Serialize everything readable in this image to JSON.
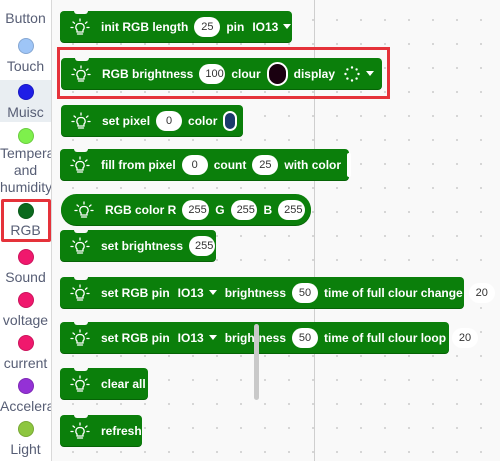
{
  "sidebar": {
    "categories": [
      {
        "label": "Button",
        "color": "#9ec5f7"
      },
      {
        "label": "Touch",
        "color": "#9ec5f7"
      },
      {
        "label": "Muisc",
        "color": "#1e1ee6"
      },
      {
        "label": "Temperature and humidity",
        "lines": [
          "Tempera",
          "and",
          "humidity"
        ],
        "color": "#7ef04c"
      },
      {
        "label": "RGB",
        "color": "#0b6a1e"
      },
      {
        "label": "Sound",
        "color": "#f0186d"
      },
      {
        "label": "voltage",
        "color": "#f0186d"
      },
      {
        "label": "current",
        "color": "#f0186d"
      },
      {
        "label": "Accelera",
        "color": "#9431d6"
      },
      {
        "label": "Light",
        "color": "#8dc63f"
      }
    ]
  },
  "blocks": {
    "init": {
      "text": "init RGB length",
      "length": "25",
      "pin_label": "pin",
      "pin": "IO13"
    },
    "brightness": {
      "text": "RGB brightness",
      "value": "100",
      "clour_label": "clour",
      "color": "#1a0010",
      "display_label": "display"
    },
    "set_pixel": {
      "text": "set pixel",
      "index": "0",
      "color_label": "color",
      "color": "#1b3a6b"
    },
    "fill": {
      "text": "fill from pixel",
      "start": "0",
      "count_label": "count",
      "count": "25",
      "with_label": "with color",
      "color": "#88ea88"
    },
    "rgb_color": {
      "text": "RGB color R",
      "r": "255",
      "g_label": "G",
      "g": "255",
      "b_label": "B",
      "b": "255"
    },
    "set_brightness": {
      "text": "set brightness",
      "value": "255"
    },
    "pin_change": {
      "text": "set RGB pin",
      "pin": "IO13",
      "brightness_label": "brightness",
      "brightness": "50",
      "time_label": "time of full clour change",
      "time": "20"
    },
    "pin_loop": {
      "text": "set RGB pin",
      "pin": "IO13",
      "brightness_label": "brightness",
      "brightness": "50",
      "time_label": "time of full clour loop",
      "time": "20"
    },
    "clear": {
      "text": "clear all"
    },
    "refresh": {
      "text": "refresh"
    }
  },
  "colors": {
    "block_green": "#0b7f0b",
    "highlight_red": "#e5323a"
  }
}
